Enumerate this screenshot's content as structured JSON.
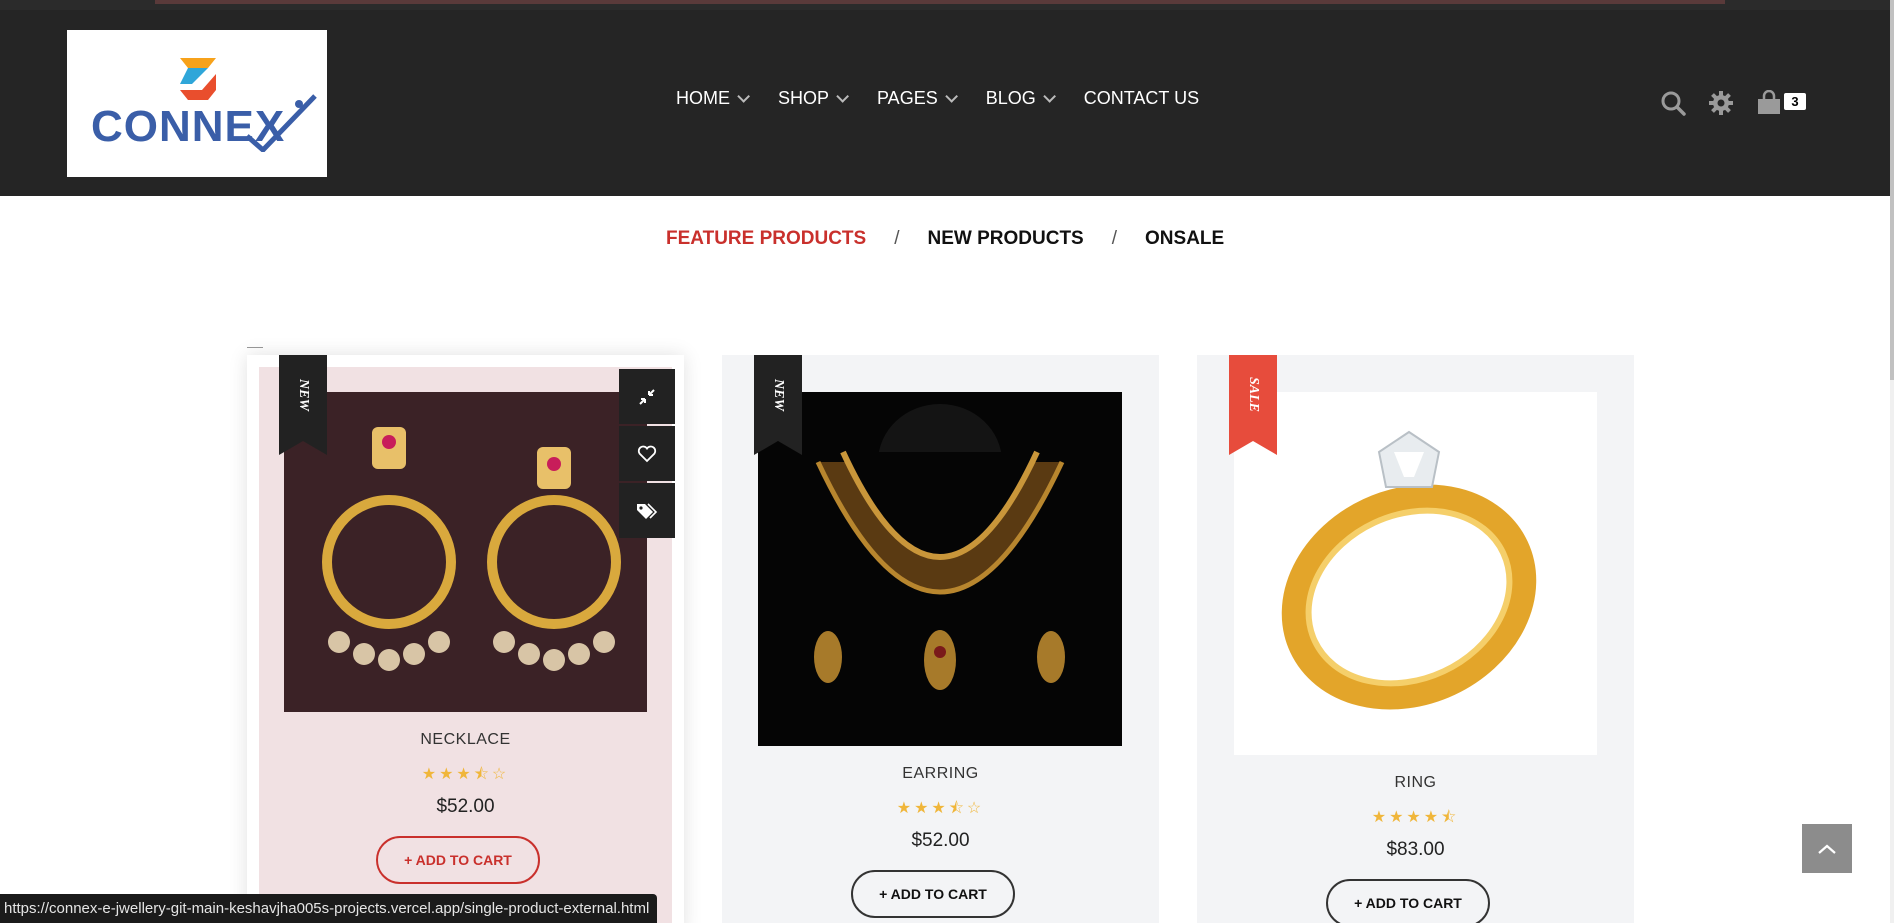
{
  "header": {
    "logo_text": "CONNEX",
    "nav": [
      {
        "label": "HOME",
        "has_dropdown": true
      },
      {
        "label": "SHOP",
        "has_dropdown": true
      },
      {
        "label": "PAGES",
        "has_dropdown": true
      },
      {
        "label": "BLOG",
        "has_dropdown": true
      },
      {
        "label": "CONTACT US",
        "has_dropdown": false
      }
    ],
    "icons": [
      "search-icon",
      "gear-icon",
      "shopping-bag-icon"
    ],
    "cart_count": "3"
  },
  "tabs": [
    {
      "label": "FEATURE PRODUCTS",
      "active": true
    },
    {
      "label": "NEW PRODUCTS",
      "active": false
    },
    {
      "label": "ONSALE",
      "active": false
    }
  ],
  "tab_separator": "/",
  "products": [
    {
      "name": "NECKLACE",
      "badge": "NEW",
      "rating": 3.5,
      "stars": "★★★⯪☆",
      "price": "$52.00",
      "cta": "+ ADD TO CART"
    },
    {
      "name": "EARRING",
      "badge": "NEW",
      "rating": 3.5,
      "stars": "★★★⯪☆",
      "price": "$52.00",
      "cta": "+ ADD TO CART"
    },
    {
      "name": "RING",
      "badge": "SALE",
      "rating": 4.5,
      "stars": "★★★★⯪",
      "price": "$83.00",
      "cta": "+ ADD TO CART"
    }
  ],
  "hover_actions": [
    "compress-icon",
    "heart-icon",
    "tags-icon"
  ],
  "status_url": "https://connex-e-jwellery-git-main-keshavjha005s-projects.vercel.app/single-product-external.html",
  "colors": {
    "header_bg": "#252525",
    "accent_red": "#c9302c",
    "star": "#f0b63a",
    "card_bg": "#f3f4f6",
    "logo_blue": "#3a5ea8"
  }
}
